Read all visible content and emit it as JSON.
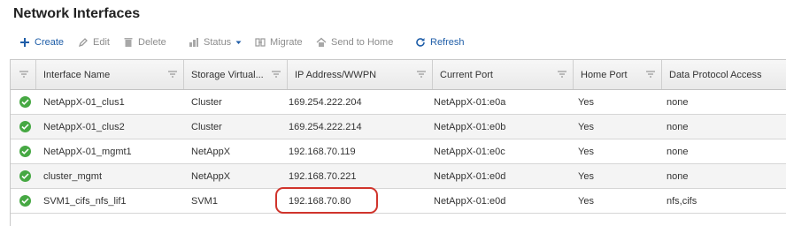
{
  "page": {
    "title": "Network Interfaces"
  },
  "toolbar": {
    "create": "Create",
    "edit": "Edit",
    "delete": "Delete",
    "status": "Status",
    "migrate": "Migrate",
    "send_to_home": "Send to Home",
    "refresh": "Refresh"
  },
  "columns": [
    "Interface Name",
    "Storage Virtual...",
    "IP Address/WWPN",
    "Current Port",
    "Home Port",
    "Data Protocol Access"
  ],
  "rows": [
    {
      "status": "online",
      "name": "NetAppX-01_clus1",
      "svm": "Cluster",
      "ip": "169.254.222.204",
      "current_port": "NetAppX-01:e0a",
      "home_port": "Yes",
      "protocol": "none"
    },
    {
      "status": "online",
      "name": "NetAppX-01_clus2",
      "svm": "Cluster",
      "ip": "169.254.222.214",
      "current_port": "NetAppX-01:e0b",
      "home_port": "Yes",
      "protocol": "none"
    },
    {
      "status": "online",
      "name": "NetAppX-01_mgmt1",
      "svm": "NetAppX",
      "ip": "192.168.70.119",
      "current_port": "NetAppX-01:e0c",
      "home_port": "Yes",
      "protocol": "none"
    },
    {
      "status": "online",
      "name": "cluster_mgmt",
      "svm": "NetAppX",
      "ip": "192.168.70.221",
      "current_port": "NetAppX-01:e0d",
      "home_port": "Yes",
      "protocol": "none"
    },
    {
      "status": "online",
      "name": "SVM1_cifs_nfs_lif1",
      "svm": "SVM1",
      "ip": "192.168.70.80",
      "current_port": "NetAppX-01:e0d",
      "home_port": "Yes",
      "protocol": "nfs,cifs"
    }
  ],
  "colors": {
    "accent": "#1f5ea8",
    "status_ok": "#46a843",
    "highlight": "#d0342c"
  }
}
